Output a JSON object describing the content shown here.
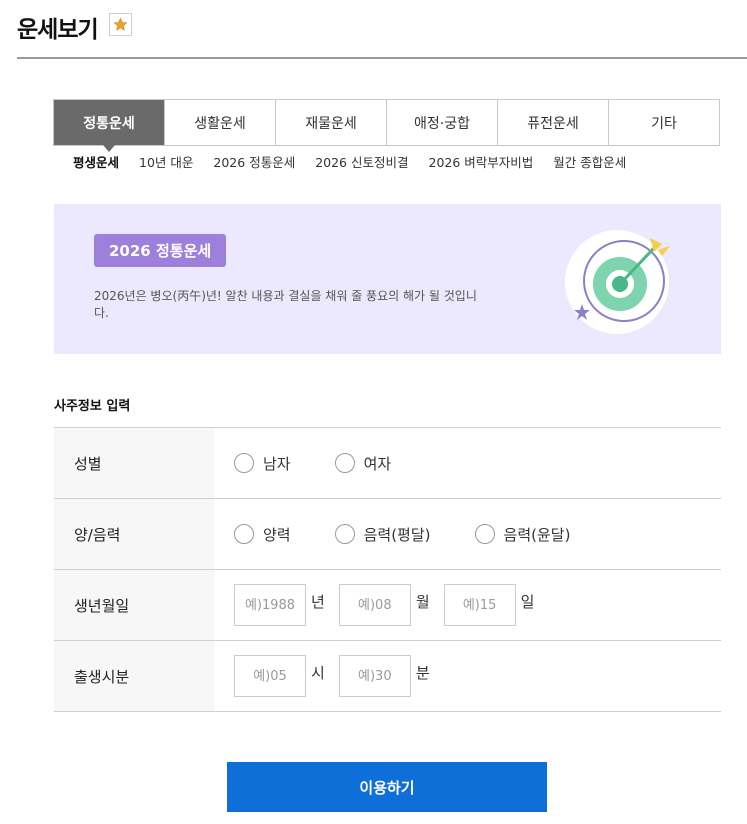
{
  "page": {
    "title": "운세보기"
  },
  "main_tabs": [
    {
      "label": "정통운세",
      "active": true
    },
    {
      "label": "생활운세",
      "active": false
    },
    {
      "label": "재물운세",
      "active": false
    },
    {
      "label": "애정·궁합",
      "active": false
    },
    {
      "label": "퓨전운세",
      "active": false
    },
    {
      "label": "기타",
      "active": false
    }
  ],
  "sub_tabs": [
    {
      "label": "평생운세",
      "active": true
    },
    {
      "label": "10년 대운",
      "active": false
    },
    {
      "label": "2026 정통운세",
      "active": false
    },
    {
      "label": "2026 신토정비결",
      "active": false
    },
    {
      "label": "2026 벼락부자비법",
      "active": false
    },
    {
      "label": "월간 종합운세",
      "active": false
    }
  ],
  "banner": {
    "badge": "2026 정통운세",
    "description": "2026년은 병오(丙午)년! 알찬 내용과 결실을 채워 줄 풍요의 해가 될 것입니다.",
    "icon": "target-icon"
  },
  "form": {
    "section_title": "사주정보 입력",
    "gender": {
      "label": "성별",
      "options": [
        "남자",
        "여자"
      ]
    },
    "calendar": {
      "label": "양/음력",
      "options": [
        "양력",
        "음력(평달)",
        "음력(윤달)"
      ]
    },
    "birth_date": {
      "label": "생년월일",
      "year_placeholder": "예)1988",
      "year_unit": "년",
      "month_placeholder": "예)08",
      "month_unit": "월",
      "day_placeholder": "예)15",
      "day_unit": "일"
    },
    "birth_time": {
      "label": "출생시분",
      "hour_placeholder": "예)05",
      "hour_unit": "시",
      "minute_placeholder": "예)30",
      "minute_unit": "분"
    },
    "submit_label": "이용하기"
  },
  "colors": {
    "active_tab": "#6a6a6a",
    "banner_bg": "#ece8fd",
    "badge_bg": "#9d7fdc",
    "submit_bg": "#0e6fd8",
    "star": "#f0a030"
  }
}
